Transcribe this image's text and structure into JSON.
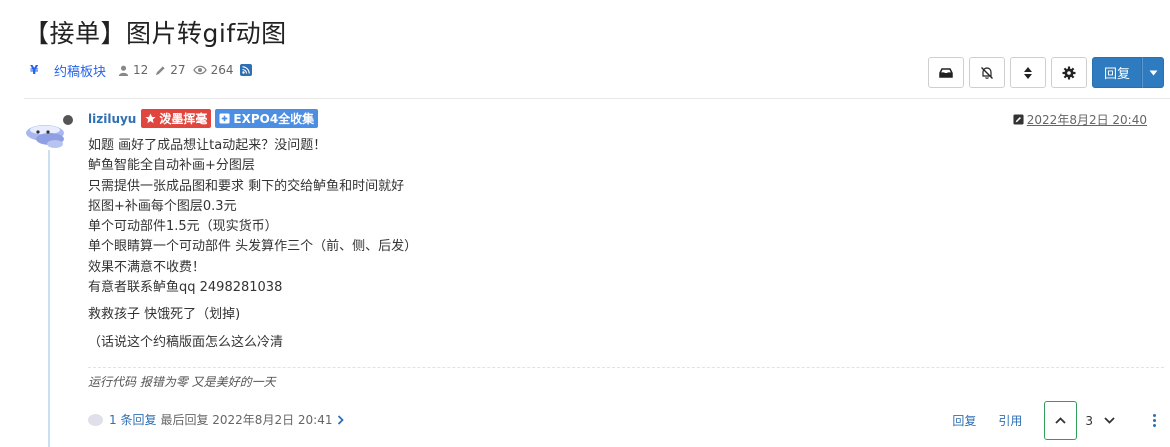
{
  "topic": {
    "title": "【接单】图片转gif动图",
    "category_icon": "¥",
    "category": "约稿板块",
    "posters": "12",
    "posts": "27",
    "views": "264"
  },
  "toolbar": {
    "reply_label": "回复",
    "icons": [
      "inbox-icon",
      "bell-slash-icon",
      "sort-icon",
      "gear-icon",
      "caret-down-icon"
    ],
    "accent": "#2f7bbf"
  },
  "post": {
    "username": "liziluyu",
    "badge1": "泼墨挥毫",
    "badge2": "EXPO4全收集",
    "badge1_color": "#e0463d",
    "badge2_color": "#4b8ee2",
    "time": "2022年8月2日 20:40",
    "lines": [
      "如题 画好了成品想让ta动起来？没问题！",
      "鲈鱼智能全自动补画+分图层",
      "只需提供一张成品图和要求 剩下的交给鲈鱼和时间就好",
      "抠图+补画每个图层0.3元",
      "单个可动部件1.5元（现实货币）",
      "单个眼睛算一个可动部件 头发算作三个（前、侧、后发）",
      "效果不满意不收费！",
      "有意者联系鲈鱼qq 2498281038"
    ],
    "line_after_1": "救救孩子 快饿死了（划掉)",
    "line_after_2": "（话说这个约稿版面怎么这么冷清",
    "signature": "运行代码 报错为零 又是美好的一天"
  },
  "footer": {
    "reply_count": "1 条回复",
    "last_reply": "最后回复 2022年8月2日 20:41",
    "reply_action": "回复",
    "quote_action": "引用",
    "votes": "3"
  }
}
